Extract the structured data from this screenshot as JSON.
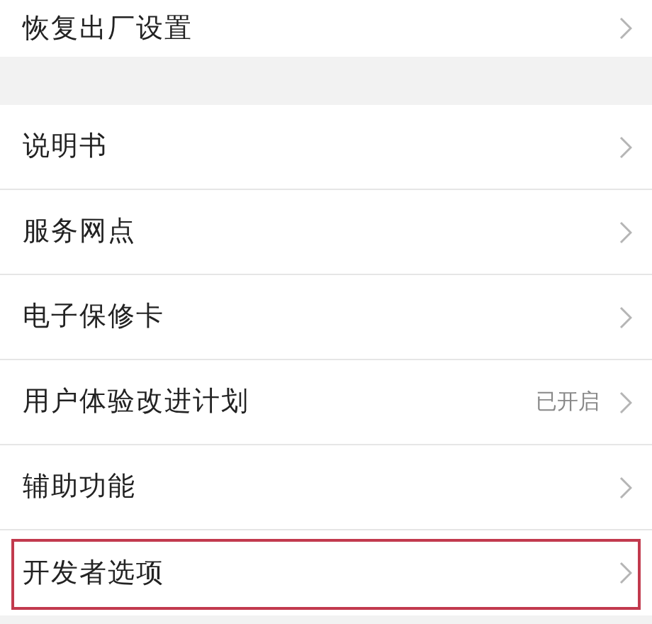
{
  "groups": [
    {
      "items": [
        {
          "label": "恢复出厂设置",
          "highlighted": false
        }
      ]
    },
    {
      "items": [
        {
          "label": "说明书",
          "highlighted": false
        },
        {
          "label": "服务网点",
          "highlighted": false
        },
        {
          "label": "电子保修卡",
          "highlighted": false
        },
        {
          "label": "用户体验改进计划",
          "value": "已开启",
          "highlighted": false
        },
        {
          "label": "辅助功能",
          "highlighted": false
        },
        {
          "label": "开发者选项",
          "highlighted": true
        }
      ]
    }
  ]
}
